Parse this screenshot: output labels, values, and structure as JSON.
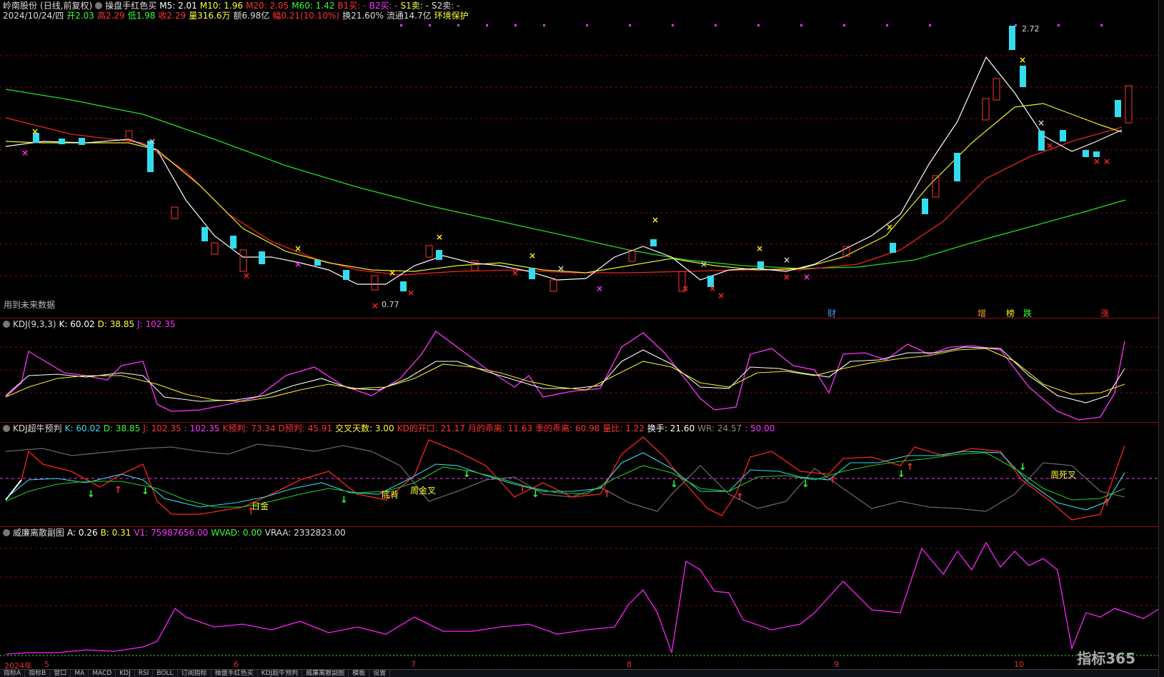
{
  "header": {
    "name": "岭南股份",
    "mode": "(日线,前复权)",
    "indicator": "操盘手红色买",
    "m5": "M5: 2.01",
    "m10": "M10: 1.96",
    "m20": "M20: 2.05",
    "m60": "M60: 1.42",
    "b1": "B1买: -",
    "b2": "B2买: -",
    "s1": "S1卖: -",
    "s2": "S2卖: -"
  },
  "quote": {
    "date": "2024/10/24/四",
    "open": "开2.03",
    "high": "高2.29",
    "low": "低1.98",
    "close": "收2.29",
    "volume": "量316.6万",
    "amount": "额6.98亿",
    "change": "幅0.21(10.10%)",
    "turnover": "换21.60%",
    "float": "流通14.7亿",
    "env": "环境保护"
  },
  "main_notes": {
    "future": "用到未来数据",
    "high_price": "2.72",
    "low_price": "0.77",
    "tag_cai": "财",
    "tag_zeng": "增",
    "tag_bang": "榜",
    "tag_die": "跌",
    "tag_zhang": "涨"
  },
  "kdj": {
    "name": "KDJ(9,3,3)",
    "k": "K: 60.02",
    "d": "D: 38.85",
    "j": "J: 102.35"
  },
  "kdj2": {
    "name": "KDJ超牛预判",
    "k": "K: 60.02",
    "d": "D: 38.85",
    "j": "J: 102.35",
    "j2": ": 102.35",
    "kpre": "K预判: 73.34",
    "dpre": "D预判: 45.91",
    "cross": "交叉天数: 3.00",
    "kdopen": "KD的开口: 21.17",
    "month": "月的乖离: 11.63",
    "season": "季的乖离: 60.98",
    "ratio": "量比: 1.22",
    "turn": "换手: 21.60",
    "wr": "WR: 24.57",
    "fifty": ": 50.00",
    "label_jin": "日金",
    "label_bei": "底背",
    "label_zhoujin": "周金叉",
    "label_zhousi": "周死叉"
  },
  "vol": {
    "name": "威廉离散副图",
    "a": "A: 0.26",
    "b": "B: 0.31",
    "v1": "V1: 75987656.00",
    "wvad": "WVAD: 0.00",
    "vraa": "VRAA: 2332823.00"
  },
  "xaxis": {
    "year": "2024年",
    "m5": "5",
    "m6": "6",
    "m7": "7",
    "m8": "8",
    "m9": "9",
    "m10": "10"
  },
  "logo": "指标365",
  "tabs": [
    "指标A",
    "指标B",
    "窗口",
    "MA",
    "MACD",
    "KDJ",
    "RSI",
    "BOLL",
    "订阅指标",
    "操盘手红色买",
    "KDJ超牛预判",
    "威廉离散副图",
    "模板",
    "设置"
  ]
}
